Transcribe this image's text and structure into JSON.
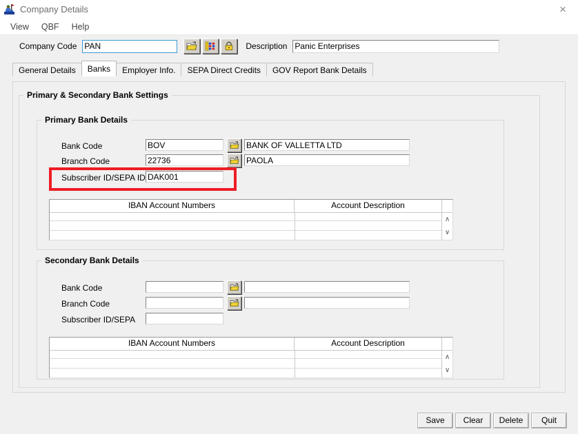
{
  "window": {
    "title": "Company Details",
    "close_label": "×",
    "app_icon": "user-badge-icon"
  },
  "menubar": {
    "items": [
      {
        "label": "View"
      },
      {
        "label": "QBF"
      },
      {
        "label": "Help"
      }
    ]
  },
  "header": {
    "company_code_label": "Company Code",
    "company_code_value": "PAN",
    "description_label": "Description",
    "description_value": "Panic Enterprises",
    "buttons": [
      {
        "icon": "open-folder-icon"
      },
      {
        "icon": "query-by-form-icon"
      },
      {
        "icon": "padlock-icon"
      }
    ]
  },
  "tabs": [
    {
      "label": "General Details",
      "active": false
    },
    {
      "label": "Banks",
      "active": true
    },
    {
      "label": "Employer Info.",
      "active": false
    },
    {
      "label": "SEPA Direct Credits",
      "active": false
    },
    {
      "label": "GOV Report Bank Details",
      "active": false
    }
  ],
  "panel": {
    "legend": "Primary & Secondary Bank Settings"
  },
  "primary": {
    "legend": "Primary Bank Details",
    "bank_code_label": "Bank Code",
    "bank_code_value": "BOV",
    "bank_name_value": "BANK OF VALLETTA LTD",
    "branch_code_label": "Branch Code",
    "branch_code_value": "22736",
    "branch_name_value": "PAOLA",
    "subscriber_label": "Subscriber ID/SEPA ID",
    "subscriber_value": "DAK001",
    "lookup_icon": "open-folder-icon",
    "grid": {
      "columns": [
        "IBAN Account Numbers",
        "Account Description"
      ],
      "rows": [],
      "scroll_up": "∧",
      "scroll_down": "∨"
    }
  },
  "secondary": {
    "legend": "Secondary Bank Details",
    "bank_code_label": "Bank Code",
    "bank_code_value": "",
    "bank_name_value": "",
    "branch_code_label": "Branch Code",
    "branch_code_value": "",
    "branch_name_value": "",
    "subscriber_label": "Subscriber ID/SEPA",
    "subscriber_value": "",
    "lookup_icon": "open-folder-icon",
    "grid": {
      "columns": [
        "IBAN Account Numbers",
        "Account Description"
      ],
      "rows": [],
      "scroll_up": "∧",
      "scroll_down": "∨"
    }
  },
  "highlight": {
    "color": "#ee1c25",
    "target": "subscriber-id-sepa-id-row"
  },
  "footer": {
    "buttons": [
      {
        "label": "Save"
      },
      {
        "label": "Clear"
      },
      {
        "label": "Delete"
      },
      {
        "label": "Quit"
      }
    ]
  }
}
